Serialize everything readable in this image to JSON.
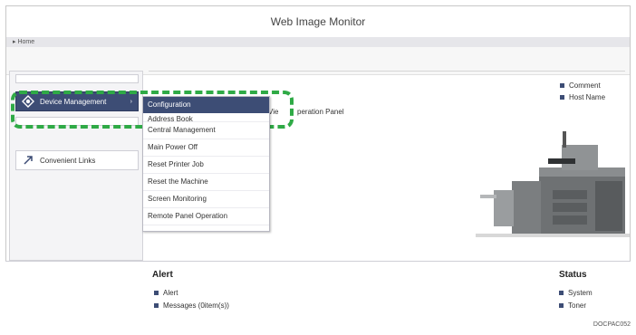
{
  "header": {
    "title": "Web Image Monitor"
  },
  "breadcrumb": {
    "label": "Home"
  },
  "sidebar": {
    "items": [
      {
        "label": "Device Management",
        "icon": "gear-diamond-icon"
      },
      {
        "label": "Convenient Links",
        "icon": "link-arrow-icon"
      }
    ]
  },
  "dropdown": {
    "items": [
      {
        "label": "Configuration"
      },
      {
        "label": "Address Book"
      },
      {
        "label": "Central Management"
      },
      {
        "label": "Main Power Off"
      },
      {
        "label": "Reset Printer Job"
      },
      {
        "label": "Reset the Machine"
      },
      {
        "label": "Screen Monitoring"
      },
      {
        "label": "Remote Panel Operation"
      }
    ]
  },
  "main": {
    "panel_text_left": "Vie",
    "panel_text_right": "peration Panel",
    "links": [
      {
        "label": "Comment"
      },
      {
        "label": "Host Name"
      }
    ]
  },
  "bottom": {
    "alert": {
      "title": "Alert",
      "items": [
        {
          "label": "Alert"
        },
        {
          "label": "Messages (0item(s))"
        }
      ]
    },
    "status": {
      "title": "Status",
      "items": [
        {
          "label": "System"
        },
        {
          "label": "Toner"
        }
      ]
    }
  },
  "figure_code": "DOCPAC052",
  "colors": {
    "accent": "#3d4d75",
    "highlight": "#2faa46"
  }
}
